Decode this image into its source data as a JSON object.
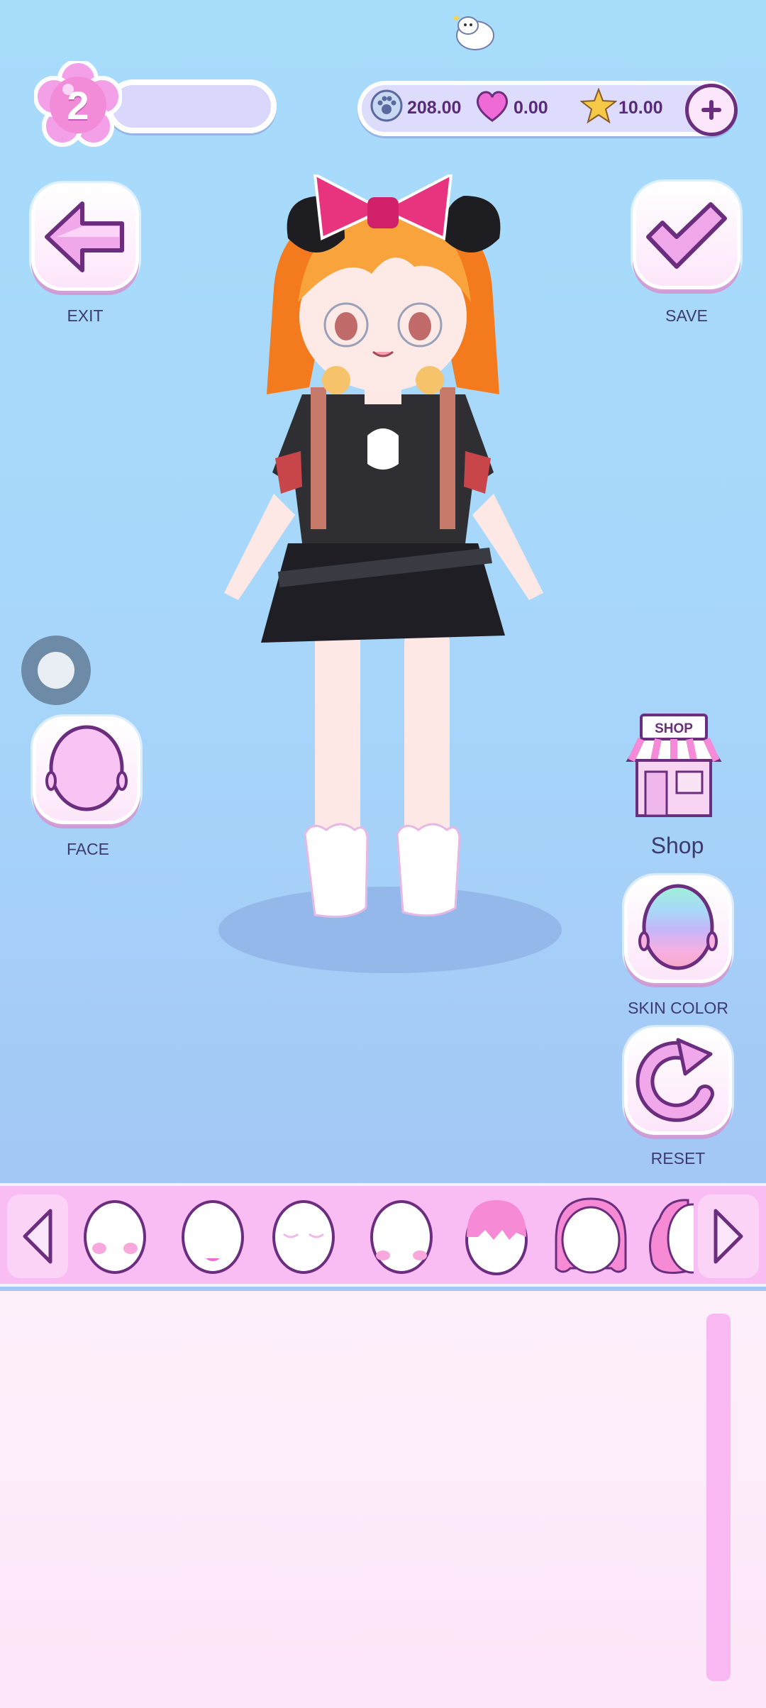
{
  "level": {
    "value": "2"
  },
  "currency": {
    "paws": "208.00",
    "hearts": "0.00",
    "stars": "10.00"
  },
  "buttons": {
    "exit_label": "EXIT",
    "save_label": "SAVE",
    "face_label": "FACE",
    "shop_label": "Shop",
    "shop_sign": "SHOP",
    "skin_color_label": "SKIN COLOR",
    "reset_label": "RESET"
  },
  "item_strip": {
    "items": [
      "face-blush",
      "face-smile",
      "face-closed-eyes",
      "face-cheeks",
      "hair-pink-bangs",
      "hair-pink-bob",
      "hair-pink-ponytail"
    ]
  },
  "colors": {
    "accent_pink": "#f28bd8",
    "dark_purple": "#6b2d7e",
    "background_blue": "#a8dcfb"
  }
}
